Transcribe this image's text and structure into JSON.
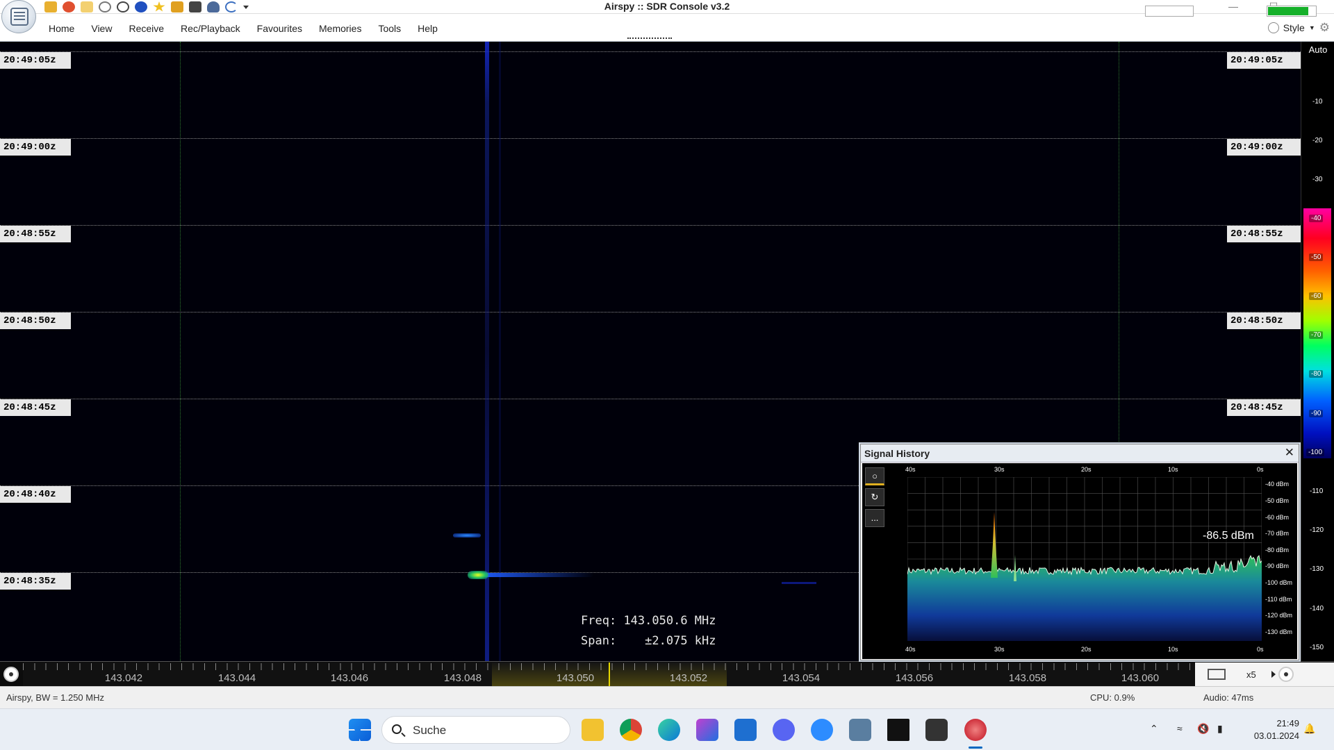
{
  "window": {
    "title": "Airspy :: SDR Console v3.2",
    "minimize": "—",
    "maximize": "☐",
    "close": ""
  },
  "menu": {
    "items": [
      "Home",
      "View",
      "Receive",
      "Rec/Playback",
      "Favourites",
      "Memories",
      "Tools",
      "Help"
    ],
    "style_label": "Style"
  },
  "waterfall": {
    "timestamps": [
      "20:49:05z",
      "20:49:00z",
      "20:48:55z",
      "20:48:50z",
      "20:48:45z",
      "20:48:40z",
      "20:48:35z"
    ],
    "readout": {
      "freq_label": "Freq:",
      "freq_value": "143.050.6 MHz",
      "span_label": "Span:",
      "span_value": "±2.075 kHz"
    }
  },
  "level_scale": {
    "auto_label": "Auto",
    "ticks": [
      "-10",
      "-20",
      "-30",
      "-40",
      "-50",
      "-60",
      "-70",
      "-80",
      "-90",
      "-100",
      "-110",
      "-120",
      "-130",
      "-140",
      "-150"
    ]
  },
  "freq_axis": {
    "labels": [
      "143.042",
      "143.044",
      "143.046",
      "143.048",
      "143.050",
      "143.052",
      "143.054",
      "143.056",
      "143.058",
      "143.060"
    ],
    "zoom": "x5"
  },
  "status": {
    "device": "Airspy, BW = 1.250 MHz",
    "cpu": "CPU: 0.9%",
    "cpu_level": 0.009,
    "audio": "Audio: 47ms",
    "audio_level": 0.85
  },
  "signal_history": {
    "title": "Signal History",
    "close": "✕",
    "tools": [
      "○",
      "↻",
      "..."
    ],
    "time_labels": [
      "40s",
      "30s",
      "20s",
      "10s",
      "0s"
    ],
    "y_labels": [
      "-40 dBm",
      "-50 dBm",
      "-60 dBm",
      "-70 dBm",
      "-80 dBm",
      "-90 dBm",
      "-100 dBm",
      "-110 dBm",
      "-120 dBm",
      "-130 dBm"
    ],
    "readout": "-86.5 dBm"
  },
  "taskbar": {
    "search_placeholder": "Suche",
    "time": "21:49",
    "date": "03.01.2024"
  },
  "colors": {
    "waterfall_bg": "#00000a",
    "passband": "#e6d800",
    "grid_h": "#8a8a8a",
    "grid_v": "#2f7a2f",
    "audio_meter": "#16b02a",
    "accent": "#0067c0"
  },
  "icons": {
    "qat": [
      "home-icon",
      "lifebuoy-icon",
      "folder-icon",
      "play-icon",
      "stop-icon",
      "add-icon",
      "star-icon",
      "lock-icon",
      "camera-icon",
      "person-icon",
      "undo-icon",
      "dropdown-icon"
    ],
    "taskbar": [
      "windows-start-icon",
      "file-explorer-icon",
      "chrome-icon",
      "edge-icon",
      "snipping-tool-icon",
      "mail-icon",
      "discord-icon",
      "zoom-icon",
      "remote-icon",
      "7zip-icon",
      "camera-app-icon",
      "sdr-console-icon"
    ]
  }
}
